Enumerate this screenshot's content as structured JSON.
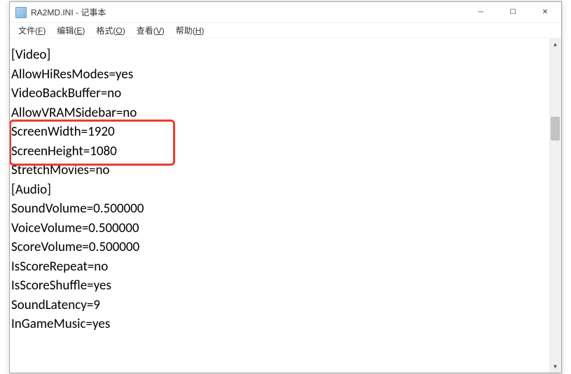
{
  "title": "RA2MD.INI - 记事本",
  "window_controls": {
    "minimize": "─",
    "maximize": "☐",
    "close": "✕"
  },
  "menu": {
    "file": {
      "label_pre": "文件(",
      "hk": "F",
      "label_post": ")"
    },
    "edit": {
      "label_pre": "编辑(",
      "hk": "E",
      "label_post": ")"
    },
    "format": {
      "label_pre": "格式(",
      "hk": "O",
      "label_post": ")"
    },
    "view": {
      "label_pre": "查看(",
      "hk": "V",
      "label_post": ")"
    },
    "help": {
      "label_pre": "帮助(",
      "hk": "H",
      "label_post": ")"
    }
  },
  "lines": [
    "",
    "[Video]",
    "AllowHiResModes=yes",
    "VideoBackBuffer=no",
    "AllowVRAMSidebar=no",
    "ScreenWidth=1920",
    "ScreenHeight=1080",
    "StretchMovies=no",
    "",
    "[Audio]",
    "SoundVolume=0.500000",
    "VoiceVolume=0.500000",
    "ScoreVolume=0.500000",
    "IsScoreRepeat=no",
    "IsScoreShuffle=yes",
    "SoundLatency=9",
    "InGameMusic=yes"
  ],
  "scroll": {
    "up": "▲",
    "down": "▼"
  }
}
